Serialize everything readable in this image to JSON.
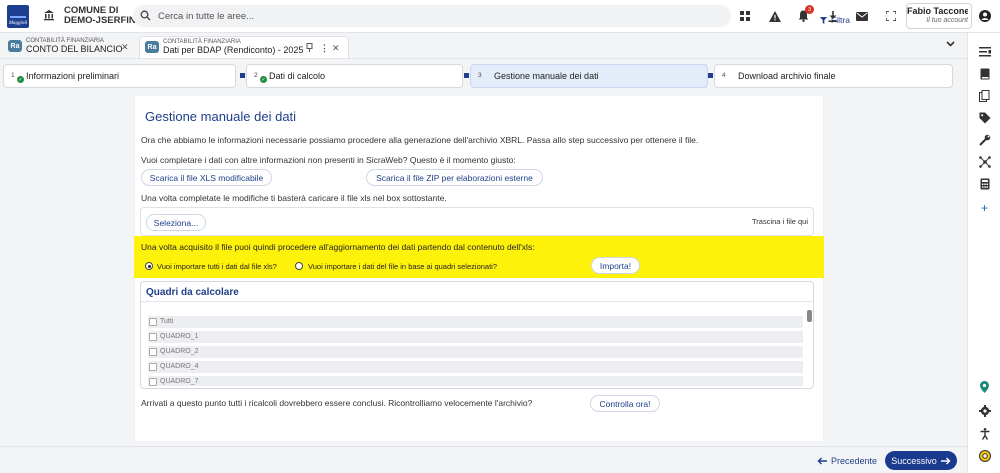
{
  "header": {
    "logo_text": "Maggioli",
    "comune_line1": "COMUNE DI",
    "comune_line2": "DEMO-JSERFIN",
    "search_placeholder": "Cerca in tutte le aree...",
    "filter_label": "Filtra",
    "notification_count": "3",
    "user_name": "Fabio Tacconell...",
    "user_account": "Il tuo account"
  },
  "tabs": [
    {
      "category": "CONTABILITÀ FINANZIARIA",
      "label": "CONTO DEL BILANCIO",
      "icon": "Ra"
    },
    {
      "category": "CONTABILITÀ FINANZIARIA",
      "label": "Dati per BDAP (Rendiconto) - 2025",
      "icon": "Ra"
    }
  ],
  "steps": [
    {
      "number": "1",
      "label": "Informazioni preliminari",
      "done": true
    },
    {
      "number": "2",
      "label": "Dati di calcolo",
      "done": true
    },
    {
      "number": "3",
      "label": "Gestione manuale dei dati",
      "active": true
    },
    {
      "number": "4",
      "label": "Download archivio finale"
    }
  ],
  "main": {
    "title": "Gestione manuale dei dati",
    "intro": "Ora che abbiamo le informazioni necessarie possiamo procedere alla generazione dell'archivio XBRL. Passa allo step successivo per ottenere il file.",
    "question": "Vuoi completare i dati con altre informazioni non presenti in SicraWeb? Questo è il momento giusto:",
    "btn_xls": "Scarica il file XLS modificabile",
    "btn_zip": "Scarica il file ZIP per elaborazioni esterne",
    "upload_hint": "Una volta completate le modifiche ti basterà caricare il file xls nel box sottostante.",
    "select_button": "Seleziona...",
    "drag_label": "Trascina i file qui",
    "import_note": "Una volta acquisito il file puoi quindi procedere all'aggiornamento dei dati partendo dal contenuto dell'xls:",
    "radio_all": "Vuoi importare tutti i dati dal file xls?",
    "radio_selected": "Vuoi importare i dati del file in base ai quadri selezionati?",
    "import_button": "Importa!",
    "quadri_title": "Quadri da calcolare",
    "quadri": [
      "Tutti",
      "QUADRO_1",
      "QUADRO_2",
      "QUADRO_4",
      "QUADRO_7"
    ],
    "check_text": "Arrivati a questo punto tutti i ricalcoli dovrebbero essere conclusi. Ricontrolliamo velocemente l'archivio?",
    "check_button": "Controlla ora!"
  },
  "footer": {
    "prev_label": "Precedente",
    "next_label": "Successivo"
  },
  "colors": {
    "brand_blue": "#1a3a8e",
    "highlight_yellow": "#fff20a",
    "success_green": "#1e8e3e"
  }
}
